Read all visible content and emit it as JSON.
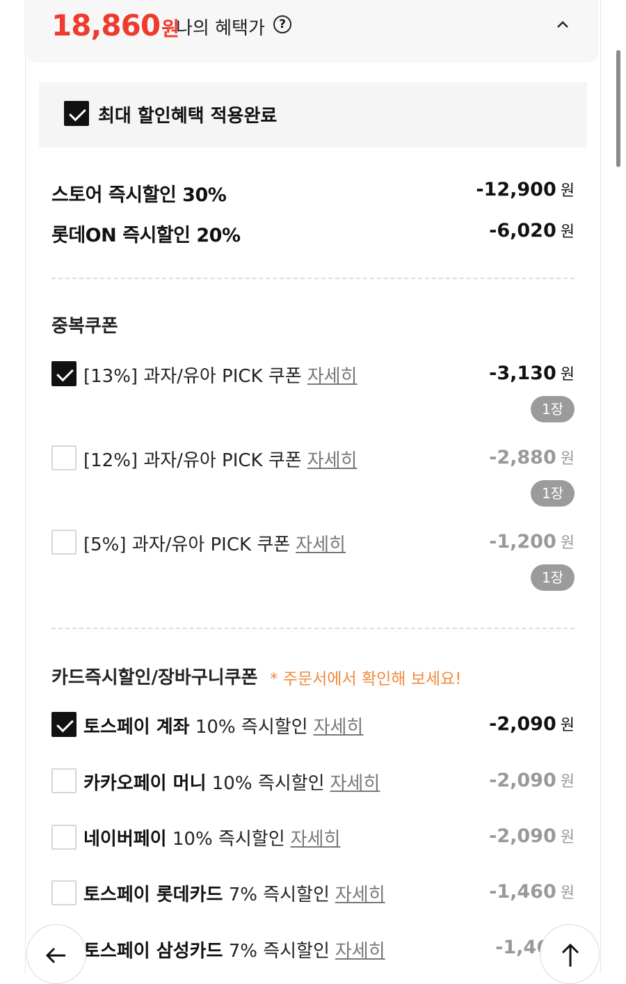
{
  "header": {
    "price": "18,860",
    "price_unit": "원",
    "benefit_label": "나의 혜택가",
    "help_icon": "question-circle-icon",
    "collapse_icon": "chevron-up-icon"
  },
  "max_discount": {
    "checked": true,
    "label": "최대 할인혜택 적용완료"
  },
  "instant_discounts": [
    {
      "label": "스토어 즉시할인 30%",
      "amount": "-12,900",
      "unit": "원"
    },
    {
      "label": "롯데ON 즉시할인 20%",
      "amount": "-6,020",
      "unit": "원"
    }
  ],
  "stack_coupons": {
    "title": "중복쿠폰",
    "items": [
      {
        "checked": true,
        "label": "[13%] 과자/유아 PICK 쿠폰",
        "detail": "자세히",
        "amount": "-3,130",
        "unit": "원",
        "qty": "1장"
      },
      {
        "checked": false,
        "label": "[12%] 과자/유아 PICK 쿠폰",
        "detail": "자세히",
        "amount": "-2,880",
        "unit": "원",
        "qty": "1장"
      },
      {
        "checked": false,
        "label": "[5%] 과자/유아 PICK 쿠폰",
        "detail": "자세히",
        "amount": "-1,200",
        "unit": "원",
        "qty": "1장"
      }
    ]
  },
  "card_discounts": {
    "title": "카드즉시할인/장바구니쿠폰",
    "note": "* 주문서에서 확인해 보세요!",
    "items": [
      {
        "checked": true,
        "name": "토스페이 계좌",
        "desc": "10% 즉시할인",
        "detail": "자세히",
        "amount": "-2,090",
        "unit": "원"
      },
      {
        "checked": false,
        "name": "카카오페이 머니",
        "desc": "10% 즉시할인",
        "detail": "자세히",
        "amount": "-2,090",
        "unit": "원"
      },
      {
        "checked": false,
        "name": "네이버페이",
        "desc": "10% 즉시할인",
        "detail": "자세히",
        "amount": "-2,090",
        "unit": "원"
      },
      {
        "checked": false,
        "name": "토스페이 롯데카드",
        "desc": "7% 즉시할인",
        "detail": "자세히",
        "amount": "-1,460",
        "unit": "원"
      },
      {
        "checked": false,
        "name": "토스페이 삼성카드",
        "desc": "7% 즉시할인",
        "detail": "자세히",
        "amount": "-1,46",
        "unit": ""
      }
    ]
  },
  "nav": {
    "back_icon": "arrow-left-icon",
    "top_icon": "arrow-up-icon"
  },
  "colors": {
    "price": "#ef3b2d",
    "note": "#f08a3c",
    "qty_badge": "#9b9b9b"
  }
}
